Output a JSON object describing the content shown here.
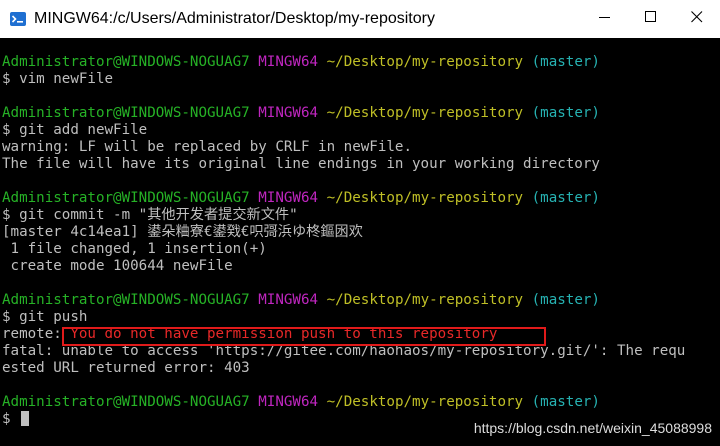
{
  "window": {
    "title": "MINGW64:/c/Users/Administrator/Desktop/my-repository",
    "icon": "mingw-terminal-icon",
    "controls": {
      "minimize_icon": "minimize-icon",
      "maximize_icon": "maximize-icon",
      "close_icon": "close-icon"
    }
  },
  "prompt": {
    "user_host": "Administrator@WINDOWS-NOGUAG7",
    "system": "MINGW64",
    "path": "~/Desktop/my-repository",
    "branch": "(master)",
    "symbol": "$"
  },
  "commands": {
    "c1": "vim newFile",
    "c2": "git add newFile",
    "c3": "git commit -m \"其他开发者提交新文件\"",
    "c4": "git push"
  },
  "output": {
    "add_warning_1": "warning: LF will be replaced by CRLF in newFile.",
    "add_warning_2": "The file will have its original line endings in your working directory",
    "commit_1": "[master 4c14ea1] 鍙朵粬寮€鍙戣€呮彁浜ゆ柊鏂囦欢",
    "commit_2": " 1 file changed, 1 insertion(+)",
    "commit_3": " create mode 100644 newFile",
    "remote_label": "remote:",
    "remote_message": " You do not have permission push to this repository",
    "fatal_1": "fatal: unable to access 'https://gitee.com/haohaos/my-repository.git/': The requ",
    "fatal_2": "ested URL returned error: 403"
  },
  "watermark": "https://blog.csdn.net/weixin_45088998",
  "colors": {
    "background": "#000000",
    "text": "#bfbfbf",
    "user_host": "#26b226",
    "system": "#bf26bf",
    "path": "#bfbf26",
    "branch": "#26b2b2",
    "error": "#e82828",
    "highlight_box": "#e01a1a"
  }
}
